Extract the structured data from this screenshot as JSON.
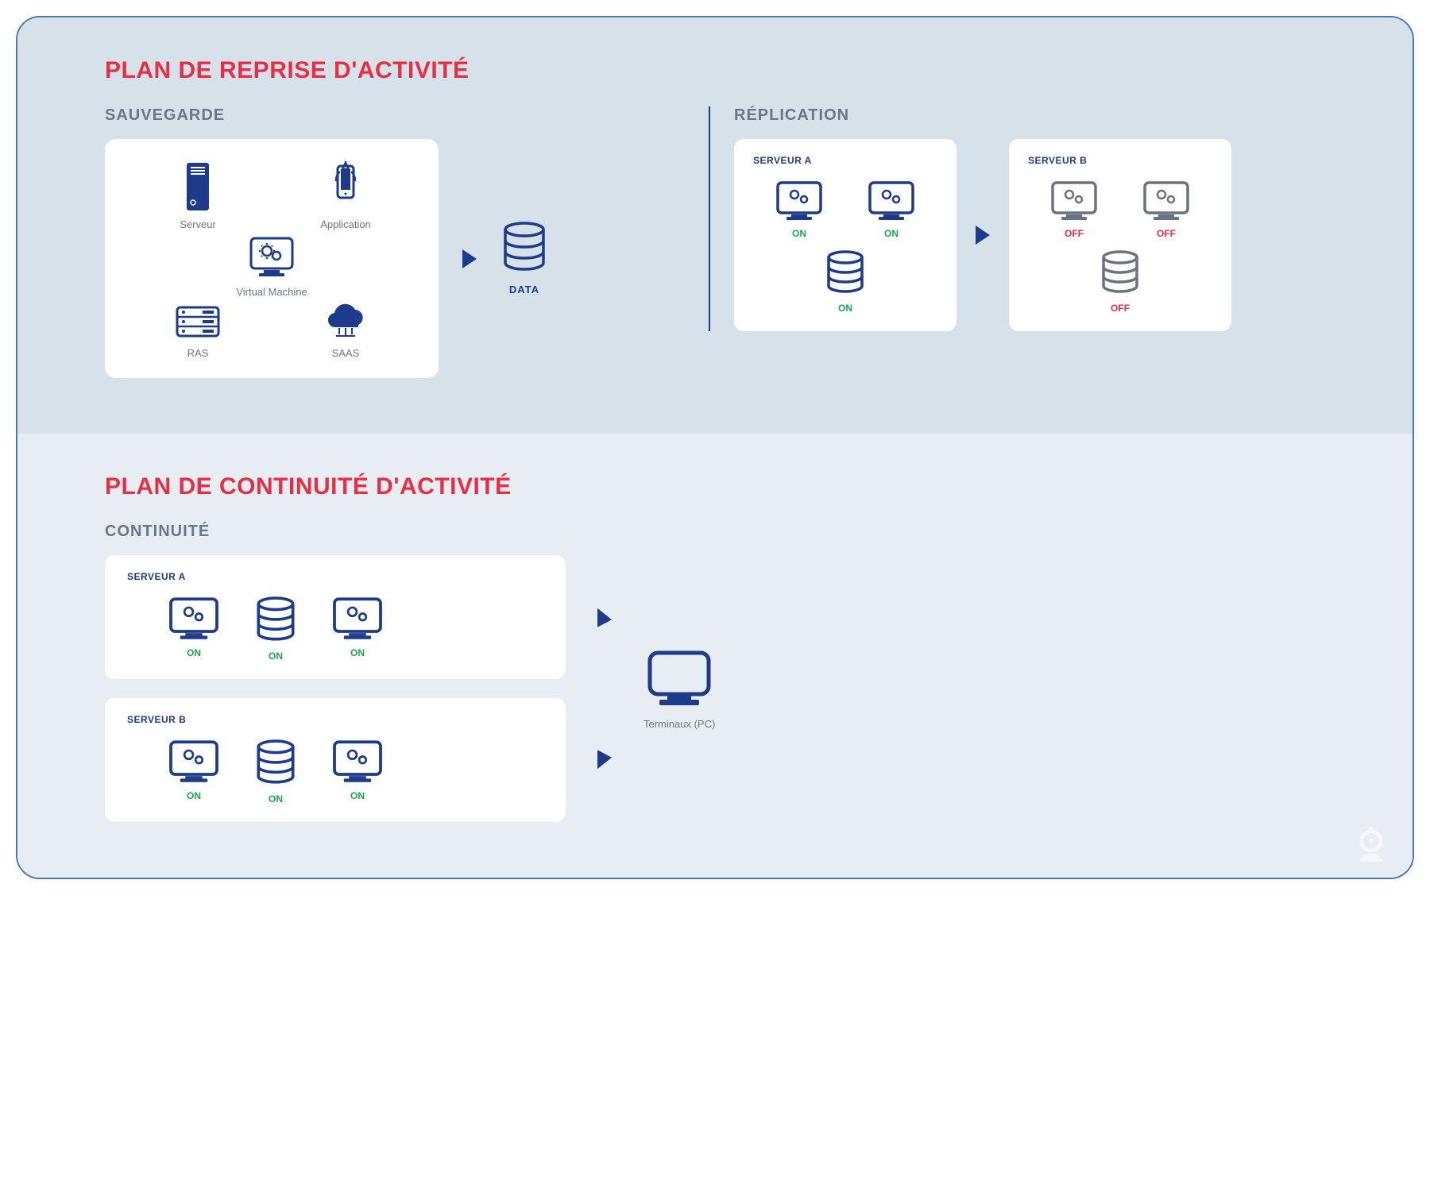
{
  "colors": {
    "primary": "#1e3a8a",
    "accent": "#e52f45",
    "on": "#1ba84a",
    "off": "#e52f45",
    "gray": "#6b7280",
    "muted": "#6b7684",
    "bg1": "#d7e1ea",
    "bg2": "#e7edf2"
  },
  "top": {
    "title": "PLAN DE REPRISE D'ACTIVITÉ",
    "sauvegarde": {
      "label": "SAUVEGARDE",
      "items": {
        "serveur": "Serveur",
        "application": "Application",
        "vm": "Virtual Machine",
        "ras": "RAS",
        "saas": "SAAS"
      },
      "data_label": "DATA"
    },
    "replication": {
      "label": "RÉPLICATION",
      "server_a": {
        "title": "SERVEUR A",
        "m1": "ON",
        "m2": "ON",
        "db": "ON"
      },
      "server_b": {
        "title": "SERVEUR B",
        "m1": "OFF",
        "m2": "OFF",
        "db": "OFF"
      }
    }
  },
  "bottom": {
    "title": "PLAN DE CONTINUITÉ D'ACTIVITÉ",
    "continuity": {
      "label": "CONTINUITÉ",
      "server_a": {
        "title": "SERVEUR A",
        "m1": "ON",
        "db": "ON",
        "m2": "ON"
      },
      "server_b": {
        "title": "SERVEUR B",
        "m1": "ON",
        "db": "ON",
        "m2": "ON"
      },
      "terminal_label": "Terminaux (PC)"
    }
  }
}
